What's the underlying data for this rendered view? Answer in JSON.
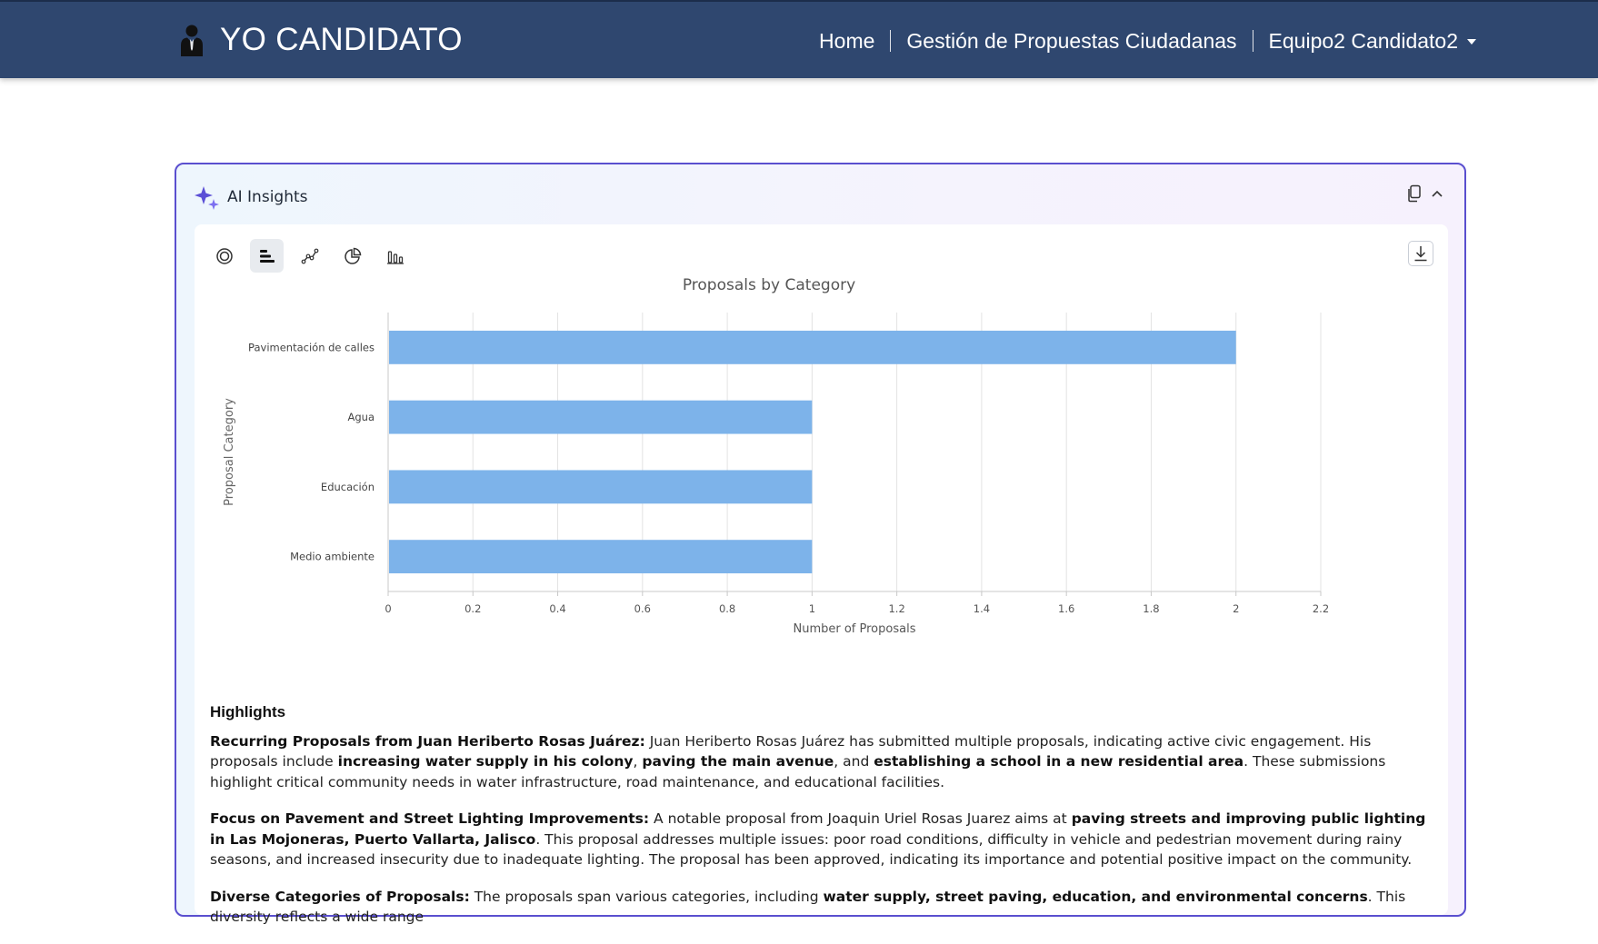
{
  "app": {
    "title": "YO CANDIDATO"
  },
  "nav": {
    "home": "Home",
    "proposals": "Gestión de Propuestas Ciudadanas",
    "user": "Equipo2 Candidato2"
  },
  "insights": {
    "title": "AI Insights"
  },
  "toolbar": {
    "icons": [
      "donut-chart-icon",
      "bar-chart-icon",
      "line-chart-icon",
      "pie-chart-icon",
      "column-chart-icon"
    ],
    "active": "bar-chart-icon"
  },
  "chart_data": {
    "type": "bar",
    "orientation": "horizontal",
    "title": "Proposals by Category",
    "xlabel": "Number of Proposals",
    "ylabel": "Proposal Category",
    "categories": [
      "Pavimentación de calles",
      "Agua",
      "Educación",
      "Medio ambiente"
    ],
    "values": [
      2,
      1,
      1,
      1
    ],
    "xlim": [
      0,
      2.2
    ],
    "xticks": [
      "0",
      "0.2",
      "0.4",
      "0.6",
      "0.8",
      "1",
      "1.2",
      "1.4",
      "1.6",
      "1.8",
      "2",
      "2.2"
    ],
    "grid": true,
    "bar_color": "#7db3ea"
  },
  "highlights": {
    "heading": "Highlights",
    "p1": {
      "lead": "Recurring Proposals from Juan Heriberto Rosas Juárez:",
      "t1": " Juan Heriberto Rosas Juárez has submitted multiple proposals, indicating active civic engagement. His proposals include ",
      "b1": "increasing water supply in his colony",
      "t2": ", ",
      "b2": "paving the main avenue",
      "t3": ", and ",
      "b3": "establishing a school in a new residential area",
      "t4": ". These submissions highlight critical community needs in water infrastructure, road maintenance, and educational facilities."
    },
    "p2": {
      "lead": "Focus on Pavement and Street Lighting Improvements:",
      "t1": " A notable proposal from Joaquin Uriel Rosas Juarez aims at ",
      "b1": "paving streets and improving public lighting in Las Mojoneras, Puerto Vallarta, Jalisco",
      "t2": ". This proposal addresses multiple issues: poor road conditions, difficulty in vehicle and pedestrian movement during rainy seasons, and increased insecurity due to inadequate lighting. The proposal has been approved, indicating its importance and potential positive impact on the community."
    },
    "p3": {
      "lead": "Diverse Categories of Proposals:",
      "t1": " The proposals span various categories, including ",
      "b1": "water supply, street paving, education, and environmental concerns",
      "t2": ". This diversity reflects a wide range"
    }
  }
}
